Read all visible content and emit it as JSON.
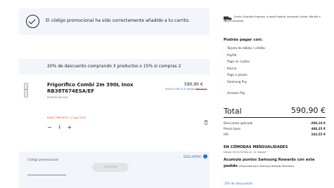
{
  "notice": {
    "text": "El código promocional ha sido correctamente añadido a tu carrito."
  },
  "promo_banner": {
    "text": "20% de descuento comprando 3 productos o 15% si compras 2"
  },
  "product": {
    "name": "Frigorífico Combi 2m 390L Inox RB38T674ESA/EF",
    "sku": "RB38T674ESA/EF",
    "price": "590,90 €",
    "saving_prefix": "Ahorra 298,10 € (antes ",
    "old_price": "889,00 €",
    "saving_suffix": ")",
    "shipping": "ENVÍO PREVISTO: 27 ago 2022",
    "quantity": "1",
    "minus": "−",
    "plus": "+"
  },
  "coupon": {
    "label": "Código promocional",
    "apply_button": "SOLICITAR",
    "discard": "DESCARTAR"
  },
  "summary": {
    "shipping_info": "Envío Gratuito Express a toda España (excepto Ceuta, Melilla e Islas Canarias)",
    "pay_title": "Podrás pagar con:",
    "pay_methods": [
      "Tarjeta de débito / crédito",
      "PayPal",
      "Pago en cuotas",
      "Klarna",
      "Pago a plazos",
      "Samsung Pay",
      "Amazon Pay"
    ],
    "total_label": "Total",
    "total_value": "590,90 €",
    "rows": [
      {
        "label": "Descuento aplicado",
        "value": "-298,10 €"
      },
      {
        "label": "Precio base",
        "value": "488,35 €"
      },
      {
        "label": "IVA",
        "value": "102,55 €"
      }
    ],
    "cuotas_title": "EN CÓMODAS MENSUALIDADES",
    "cuotas_sub": "Desde 49,24 €/mes en 12 meses*",
    "rewards_text": "Acumula puntos Samsung Rewards con este pedido",
    "rewards_note": "(Disponible para Samsung Rewards Members)",
    "extra_discount": "¡5% de descuento!"
  },
  "colors": {
    "accent_blue": "#2a6ad8",
    "shipping_orange": "#d9541e",
    "panel_bg": "#f2f5fa"
  }
}
